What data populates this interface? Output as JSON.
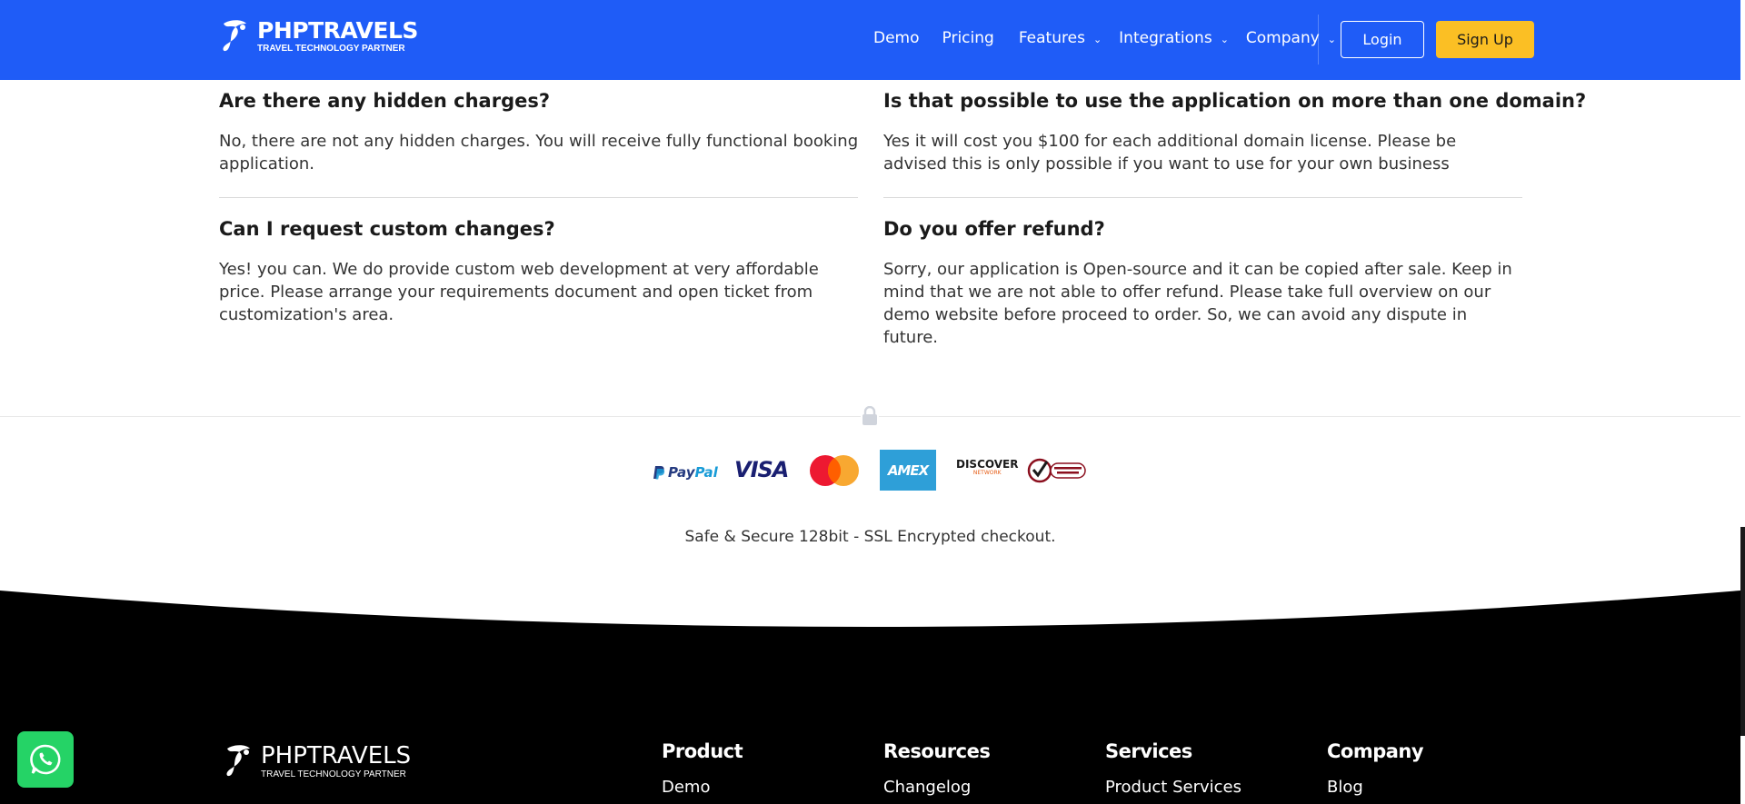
{
  "header": {
    "brand_name": "PHPTRAVELS",
    "brand_tagline": "TRAVEL TECHNOLOGY PARTNER",
    "nav": [
      {
        "label": "Demo",
        "has_dropdown": false
      },
      {
        "label": "Pricing",
        "has_dropdown": false
      },
      {
        "label": "Features",
        "has_dropdown": true
      },
      {
        "label": "Integrations",
        "has_dropdown": true
      },
      {
        "label": "Company",
        "has_dropdown": true
      }
    ],
    "login_label": "Login",
    "signup_label": "Sign Up"
  },
  "faq": [
    {
      "question": "Are there any hidden charges?",
      "answer": "No, there are not any hidden charges. You will receive fully functional booking application."
    },
    {
      "question": "Is that possible to use the application on more than one domain?",
      "answer": "Yes it will cost you $100 for each additional domain license. Please be advised this is only possible if you want to use for your own business"
    },
    {
      "question": "Can I request custom changes?",
      "answer": "Yes! you can. We do provide custom web development at very affordable price. Please arrange your requirements document and open ticket from customization's area."
    },
    {
      "question": "Do you offer refund?",
      "answer": "Sorry, our application is Open-source and it can be copied after sale. Keep in mind that we are not able to offer refund. Please take full overview on our demo website before proceed to order. So, we can avoid any dispute in future."
    }
  ],
  "payments": {
    "paypal_a": "Pay",
    "paypal_b": "Pal",
    "visa": "VISA",
    "amex": "AMEX",
    "discover": "DISCOVER",
    "discover_sub": "NETWORK",
    "secure_text": "Safe & Secure 128bit - SSL Encrypted checkout."
  },
  "footer": {
    "brand_name": "PHPTRAVELS",
    "brand_tagline": "TRAVEL TECHNOLOGY PARTNER",
    "columns": [
      {
        "title": "Product",
        "links": [
          "Demo"
        ]
      },
      {
        "title": "Resources",
        "links": [
          "Changelog"
        ]
      },
      {
        "title": "Services",
        "links": [
          "Product Services"
        ]
      },
      {
        "title": "Company",
        "links": [
          "Blog"
        ]
      }
    ]
  },
  "colors": {
    "header_bg": "#1f5cf7",
    "signup_bg": "#fbbf24",
    "footer_bg": "#000000",
    "whatsapp": "#25d366"
  },
  "icons": [
    "brand-logo-icon",
    "chevron-down-icon",
    "lock-icon",
    "whatsapp-icon"
  ]
}
